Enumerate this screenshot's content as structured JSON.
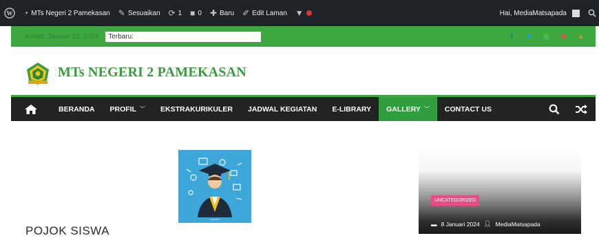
{
  "admin_bar": {
    "site_name": "MTs Negeri 2 Pamekasan",
    "customize": "Sesuaikan",
    "updates_count": "1",
    "comments_count": "0",
    "new_label": "Baru",
    "edit_label": "Edit Laman",
    "greeting": "Hai, MediaMatsapada"
  },
  "topbar": {
    "date": "Jumat, Januari 12, 2024",
    "ticker_label": "Terbaru:"
  },
  "header": {
    "site_title": "MTs NEGERI 2 PAMEKASAN"
  },
  "nav": {
    "items": [
      {
        "label": "BERANDA"
      },
      {
        "label": "PROFIL",
        "dropdown": true
      },
      {
        "label": "EKSTRAKURIKULER"
      },
      {
        "label": "JADWAL KEGIATAN"
      },
      {
        "label": "E-LIBRARY"
      },
      {
        "label": "GALLERY",
        "dropdown": true,
        "active": true
      },
      {
        "label": "CONTACT US"
      }
    ]
  },
  "content": {
    "section_title": "POJOK SISWA",
    "card": {
      "category": "UNCATEGORIZED",
      "date": "8 Januari 2024",
      "author": "MediaMatsapada"
    }
  },
  "colors": {
    "admin_bar": "#1d2327",
    "brand_green": "#3fa740",
    "nav_bg": "#232323",
    "category_pink": "#e94b86"
  }
}
